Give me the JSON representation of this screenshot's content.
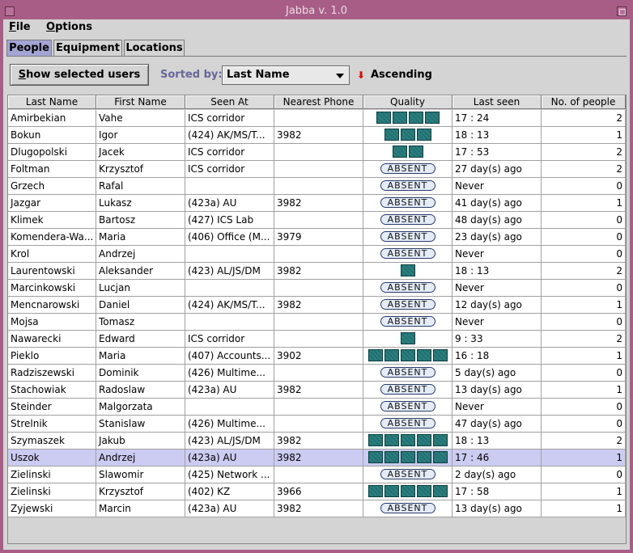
{
  "window": {
    "title": "Jabba v. 1.0"
  },
  "menu": {
    "file": "File",
    "options": "Options"
  },
  "tabs": [
    "People",
    "Equipment",
    "Locations"
  ],
  "toolbar": {
    "show_selected_label": "Show selected users",
    "sorted_by_label": "Sorted by:",
    "sort_field": "Last Name",
    "sort_order": "Ascending"
  },
  "table": {
    "columns": [
      "Last Name",
      "First Name",
      "Seen At",
      "Nearest Phone",
      "Quality",
      "Last seen",
      "No. of people"
    ],
    "absent_label": "ABSENT",
    "rows": [
      {
        "last": "Amirbekian",
        "first": "Vahe",
        "seen": "ICS corridor",
        "phone": "",
        "quality": 4,
        "lastseen": "17 : 24",
        "count": "2"
      },
      {
        "last": "Bokun",
        "first": "Igor",
        "seen": "(424)  AK/MS/T...",
        "phone": "3982",
        "quality": 3,
        "lastseen": "18 : 13",
        "count": "1"
      },
      {
        "last": "Dlugopolski",
        "first": "Jacek",
        "seen": "ICS corridor",
        "phone": "",
        "quality": 2,
        "lastseen": "17 : 53",
        "count": "2"
      },
      {
        "last": "Foltman",
        "first": "Krzysztof",
        "seen": "ICS corridor",
        "phone": "",
        "quality": 0,
        "lastseen": "27 day(s) ago",
        "count": "2"
      },
      {
        "last": "Grzech",
        "first": "Rafal",
        "seen": "",
        "phone": "",
        "quality": 0,
        "lastseen": "Never",
        "count": "0"
      },
      {
        "last": "Jazgar",
        "first": "Lukasz",
        "seen": "(423a)  AU",
        "phone": "3982",
        "quality": 0,
        "lastseen": "41 day(s) ago",
        "count": "1"
      },
      {
        "last": "Klimek",
        "first": "Bartosz",
        "seen": "(427)  ICS Lab",
        "phone": "",
        "quality": 0,
        "lastseen": "48 day(s) ago",
        "count": "0"
      },
      {
        "last": "Komendera-Wa...",
        "first": "Maria",
        "seen": "(406)  Office (M...",
        "phone": "3979",
        "quality": 0,
        "lastseen": "23 day(s) ago",
        "count": "0"
      },
      {
        "last": "Krol",
        "first": "Andrzej",
        "seen": "",
        "phone": "",
        "quality": 0,
        "lastseen": "Never",
        "count": "0"
      },
      {
        "last": "Laurentowski",
        "first": "Aleksander",
        "seen": "(423)  AL/JS/DM",
        "phone": "3982",
        "quality": 1,
        "lastseen": "18 : 13",
        "count": "2"
      },
      {
        "last": "Marcinkowski",
        "first": "Lucjan",
        "seen": "",
        "phone": "",
        "quality": 0,
        "lastseen": "Never",
        "count": "0"
      },
      {
        "last": "Mencnarowski",
        "first": "Daniel",
        "seen": "(424)  AK/MS/T...",
        "phone": "3982",
        "quality": 0,
        "lastseen": "12 day(s) ago",
        "count": "1"
      },
      {
        "last": "Mojsa",
        "first": "Tomasz",
        "seen": "",
        "phone": "",
        "quality": 0,
        "lastseen": "Never",
        "count": "0"
      },
      {
        "last": "Nawarecki",
        "first": "Edward",
        "seen": "ICS corridor",
        "phone": "",
        "quality": 1,
        "lastseen": "9 : 33",
        "count": "2"
      },
      {
        "last": "Pieklo",
        "first": "Maria",
        "seen": "(407)  Accounts...",
        "phone": "3902",
        "quality": 5,
        "lastseen": "16 : 18",
        "count": "1"
      },
      {
        "last": "Radziszewski",
        "first": "Dominik",
        "seen": "(426)  Multime...",
        "phone": "",
        "quality": 0,
        "lastseen": "5 day(s) ago",
        "count": "0"
      },
      {
        "last": "Stachowiak",
        "first": "Radoslaw",
        "seen": "(423a)  AU",
        "phone": "3982",
        "quality": 0,
        "lastseen": "13 day(s) ago",
        "count": "1"
      },
      {
        "last": "Steinder",
        "first": "Malgorzata",
        "seen": "",
        "phone": "",
        "quality": 0,
        "lastseen": "Never",
        "count": "0"
      },
      {
        "last": "Strelnik",
        "first": "Stanislaw",
        "seen": "(426)  Multime...",
        "phone": "",
        "quality": 0,
        "lastseen": "47 day(s) ago",
        "count": "0"
      },
      {
        "last": "Szymaszek",
        "first": "Jakub",
        "seen": "(423)  AL/JS/DM",
        "phone": "3982",
        "quality": 5,
        "lastseen": "18 : 13",
        "count": "2"
      },
      {
        "last": "Uszok",
        "first": "Andrzej",
        "seen": "(423a)  AU",
        "phone": "3982",
        "quality": 5,
        "lastseen": "17 : 46",
        "count": "1",
        "selected": true
      },
      {
        "last": "Zielinski",
        "first": "Slawomir",
        "seen": "(425)  Network ...",
        "phone": "",
        "quality": 0,
        "lastseen": "2 day(s) ago",
        "count": "0"
      },
      {
        "last": "Zielinski",
        "first": "Krzysztof",
        "seen": "(402)  KZ",
        "phone": "3966",
        "quality": 5,
        "lastseen": "17 : 58",
        "count": "1"
      },
      {
        "last": "Zyjewski",
        "first": "Marcin",
        "seen": "(423a)  AU",
        "phone": "3982",
        "quality": 0,
        "lastseen": "13 day(s) ago",
        "count": "1"
      }
    ]
  },
  "colors": {
    "titlebar": "#a85d86",
    "selected_row": "#ccccf2",
    "quality_bar": "#2a7f7f",
    "active_tab": "#a4a4d4"
  }
}
